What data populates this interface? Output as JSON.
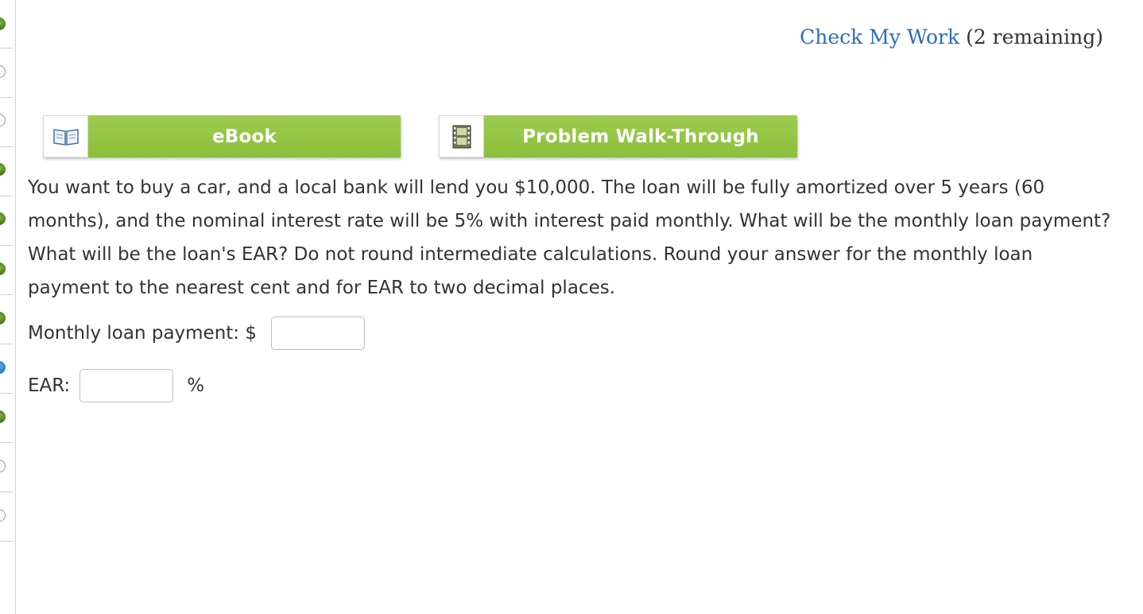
{
  "rail": {
    "items": [
      {
        "status": "done"
      },
      {
        "status": "open"
      },
      {
        "status": "open"
      },
      {
        "status": "done"
      },
      {
        "status": "done"
      },
      {
        "status": "done"
      },
      {
        "status": "done"
      },
      {
        "status": "current"
      },
      {
        "status": "done"
      },
      {
        "status": "open"
      },
      {
        "status": "open"
      }
    ]
  },
  "header": {
    "check_work_label": "Check My Work",
    "remaining_text": "(2 remaining)"
  },
  "resources": {
    "ebook": {
      "label": "eBook",
      "icon": "book-icon"
    },
    "walkthrough": {
      "label": "Problem Walk-Through",
      "icon": "film-icon"
    }
  },
  "question": {
    "text": "You want to buy a car, and a local bank will lend you $10,000. The loan will be fully amortized over 5 years (60 months), and the nominal interest rate will be 5% with interest paid monthly. What will be the monthly loan payment? What will be the loan's EAR? Do not round intermediate calculations. Round your answer for the monthly loan payment to the nearest cent and for EAR to two decimal places."
  },
  "answers": {
    "payment": {
      "label": "Monthly loan payment: $",
      "value": ""
    },
    "ear": {
      "label": "EAR:",
      "value": "",
      "unit": "%"
    }
  },
  "colors": {
    "link": "#2a6ebb",
    "button_green": "#8cbf3b",
    "rail_done": "#4f8a22",
    "rail_current": "#1f6fbd"
  }
}
